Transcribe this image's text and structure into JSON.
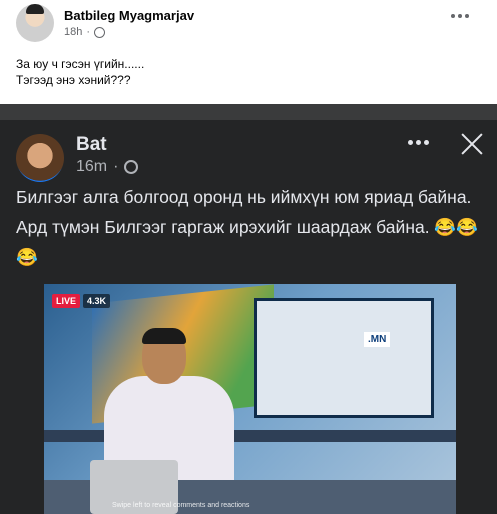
{
  "post": {
    "author": "Batbileg Myagmarjav",
    "time": "18h",
    "caption_line1": "За юу ч гэсэн үгийн......",
    "caption_line2": "Тэгээд энэ хэний???"
  },
  "shared": {
    "author": "Bat",
    "time": "16m",
    "text": "Билгээг алга болгоод оронд нь иймхүн юм яриад байна. Ард түмэн Билгээг гаргаж ирэхийг шаардаж байна. 😂😂😂",
    "video": {
      "live_label": "LIVE",
      "viewers": "4.3K",
      "screen_text": ".MN",
      "overlay_text": "Swipe left to reveal comments and reactions"
    }
  },
  "icons": {
    "post_globe": "globe-icon",
    "post_more": "more-icon",
    "shared_globe": "globe-icon",
    "shared_more": "more-icon",
    "close": "close-icon"
  },
  "colors": {
    "dark_card": "#242526",
    "text_light": "#e4e6eb",
    "live_red": "#e41e3f"
  }
}
